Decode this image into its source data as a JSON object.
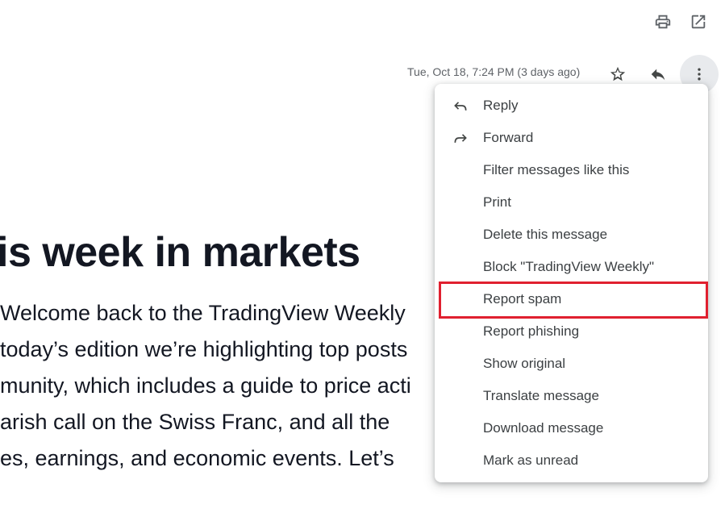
{
  "toolbar": {
    "print_icon": "print-icon",
    "open_new_window_icon": "open-in-new-window-icon"
  },
  "message_header": {
    "date": "Tue, Oct 18, 7:24 PM (3 days ago)",
    "star_icon": "star-icon",
    "reply_icon": "reply-icon",
    "more_icon": "more-vertical-icon"
  },
  "email": {
    "heading": "is week in markets",
    "lines": [
      " Welcome back to the TradingView Weekly",
      " today’s edition we’re highlighting top posts",
      "munity, which includes a guide to price acti",
      "arish call on the Swiss Franc, and all the",
      "es, earnings, and economic events. Let’s"
    ]
  },
  "menu": {
    "items": [
      {
        "label": "Reply",
        "icon": "reply-icon"
      },
      {
        "label": "Forward",
        "icon": "forward-icon"
      },
      {
        "label": "Filter messages like this",
        "icon": ""
      },
      {
        "label": "Print",
        "icon": ""
      },
      {
        "label": "Delete this message",
        "icon": ""
      },
      {
        "label": "Block \"TradingView Weekly\"",
        "icon": ""
      },
      {
        "label": "Report spam",
        "icon": ""
      },
      {
        "label": "Report phishing",
        "icon": ""
      },
      {
        "label": "Show original",
        "icon": ""
      },
      {
        "label": "Translate message",
        "icon": ""
      },
      {
        "label": "Download message",
        "icon": ""
      },
      {
        "label": "Mark as unread",
        "icon": ""
      }
    ],
    "highlighted_item": "Report spam"
  },
  "colors": {
    "highlight_border": "#e0202f",
    "menu_text": "#3c4043",
    "date_text": "#5f6368",
    "heading_text": "#131722",
    "more_button_bg": "#e8eaed"
  }
}
